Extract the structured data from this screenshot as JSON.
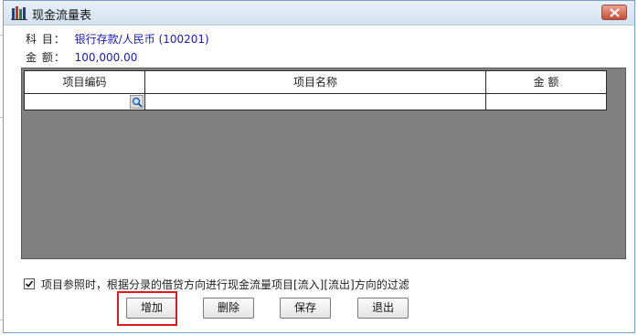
{
  "window": {
    "title": "现金流量表"
  },
  "info": {
    "subject_label": "科 目：",
    "subject_value": "银行存款/人民币 (100201)",
    "amount_label": "金 额：",
    "amount_value": "100,000.00"
  },
  "table": {
    "columns": [
      "项目编码",
      "项目名称",
      "金 额"
    ],
    "rows": [
      {
        "code": "",
        "name": "",
        "amount": ""
      }
    ]
  },
  "filter": {
    "checked": true,
    "label": "项目参照时，根据分录的借贷方向进行现金流量项目[流入][流出]方向的过滤"
  },
  "buttons": {
    "add": "增加",
    "delete": "删除",
    "save": "保存",
    "exit": "退出"
  },
  "icons": {
    "app": "book-stack-icon",
    "close": "close-icon",
    "lookup": "magnifier-icon",
    "check": "checkmark-icon"
  },
  "colors": {
    "value_text": "#1a1ab0",
    "grid_background": "#808080",
    "highlight": "#e0191c"
  }
}
